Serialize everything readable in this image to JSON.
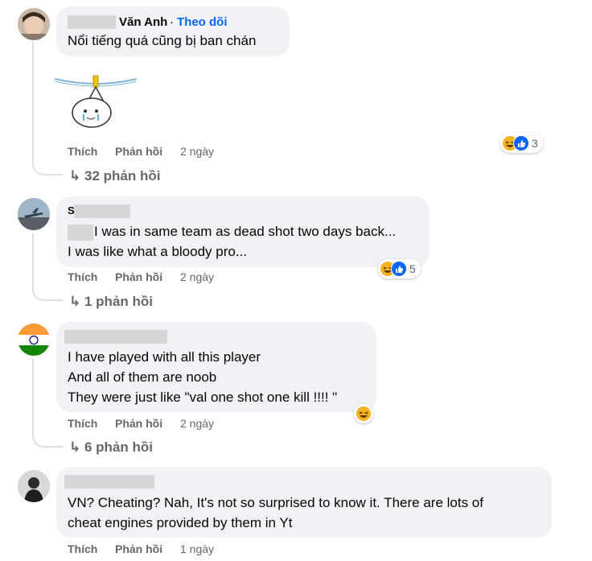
{
  "comments": [
    {
      "author": "Văn Anh",
      "follow_label": "Theo dõi",
      "text": "Nổi tiếng quá cũng bị ban chán",
      "like_label": "Thích",
      "reply_label": "Phản hồi",
      "time": "2 ngày",
      "reaction_count": "3",
      "replies_label": "32 phản hồi"
    },
    {
      "author_initial": "S",
      "lines": [
        "I was in same team as dead shot two days back...",
        "I was like what a bloody pro..."
      ],
      "like_label": "Thích",
      "reply_label": "Phản hồi",
      "time": "2 ngày",
      "reaction_count": "5",
      "replies_label": "1 phản hồi"
    },
    {
      "lines": [
        "I have played with all this player",
        "And all of them are noob",
        "They were just like \"val one shot one kill !!!! \""
      ],
      "like_label": "Thích",
      "reply_label": "Phản hồi",
      "time": "2 ngày",
      "replies_label": "6 phản hồi"
    },
    {
      "lines": [
        "VN? Cheating? Nah, It's not so surprised to know it. There are lots of",
        "cheat engines provided by them in Yt"
      ],
      "like_label": "Thích",
      "reply_label": "Phản hồi",
      "time": "1 ngày"
    }
  ],
  "icons": {
    "reply_arrow": "reply-arrow-icon",
    "haha": "haha-reaction-icon",
    "like": "like-reaction-icon"
  },
  "colors": {
    "bubble_bg": "#f0f2f5",
    "follow_blue": "#0866ff",
    "meta_grey": "#65676b",
    "haha_yellow": "#f7b125"
  }
}
